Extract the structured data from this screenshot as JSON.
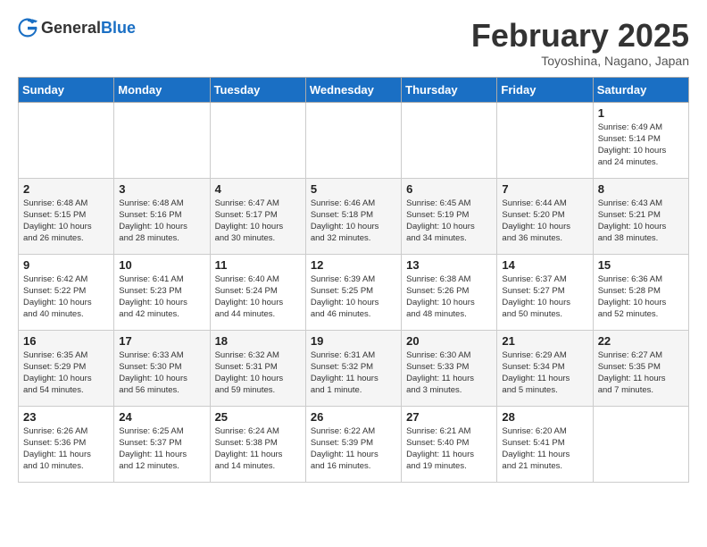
{
  "header": {
    "logo": {
      "general": "General",
      "blue": "Blue"
    },
    "title": "February 2025",
    "subtitle": "Toyoshina, Nagano, Japan"
  },
  "weekdays": [
    "Sunday",
    "Monday",
    "Tuesday",
    "Wednesday",
    "Thursday",
    "Friday",
    "Saturday"
  ],
  "weeks": [
    [
      {
        "day": "",
        "info": ""
      },
      {
        "day": "",
        "info": ""
      },
      {
        "day": "",
        "info": ""
      },
      {
        "day": "",
        "info": ""
      },
      {
        "day": "",
        "info": ""
      },
      {
        "day": "",
        "info": ""
      },
      {
        "day": "1",
        "info": "Sunrise: 6:49 AM\nSunset: 5:14 PM\nDaylight: 10 hours\nand 24 minutes."
      }
    ],
    [
      {
        "day": "2",
        "info": "Sunrise: 6:48 AM\nSunset: 5:15 PM\nDaylight: 10 hours\nand 26 minutes."
      },
      {
        "day": "3",
        "info": "Sunrise: 6:48 AM\nSunset: 5:16 PM\nDaylight: 10 hours\nand 28 minutes."
      },
      {
        "day": "4",
        "info": "Sunrise: 6:47 AM\nSunset: 5:17 PM\nDaylight: 10 hours\nand 30 minutes."
      },
      {
        "day": "5",
        "info": "Sunrise: 6:46 AM\nSunset: 5:18 PM\nDaylight: 10 hours\nand 32 minutes."
      },
      {
        "day": "6",
        "info": "Sunrise: 6:45 AM\nSunset: 5:19 PM\nDaylight: 10 hours\nand 34 minutes."
      },
      {
        "day": "7",
        "info": "Sunrise: 6:44 AM\nSunset: 5:20 PM\nDaylight: 10 hours\nand 36 minutes."
      },
      {
        "day": "8",
        "info": "Sunrise: 6:43 AM\nSunset: 5:21 PM\nDaylight: 10 hours\nand 38 minutes."
      }
    ],
    [
      {
        "day": "9",
        "info": "Sunrise: 6:42 AM\nSunset: 5:22 PM\nDaylight: 10 hours\nand 40 minutes."
      },
      {
        "day": "10",
        "info": "Sunrise: 6:41 AM\nSunset: 5:23 PM\nDaylight: 10 hours\nand 42 minutes."
      },
      {
        "day": "11",
        "info": "Sunrise: 6:40 AM\nSunset: 5:24 PM\nDaylight: 10 hours\nand 44 minutes."
      },
      {
        "day": "12",
        "info": "Sunrise: 6:39 AM\nSunset: 5:25 PM\nDaylight: 10 hours\nand 46 minutes."
      },
      {
        "day": "13",
        "info": "Sunrise: 6:38 AM\nSunset: 5:26 PM\nDaylight: 10 hours\nand 48 minutes."
      },
      {
        "day": "14",
        "info": "Sunrise: 6:37 AM\nSunset: 5:27 PM\nDaylight: 10 hours\nand 50 minutes."
      },
      {
        "day": "15",
        "info": "Sunrise: 6:36 AM\nSunset: 5:28 PM\nDaylight: 10 hours\nand 52 minutes."
      }
    ],
    [
      {
        "day": "16",
        "info": "Sunrise: 6:35 AM\nSunset: 5:29 PM\nDaylight: 10 hours\nand 54 minutes."
      },
      {
        "day": "17",
        "info": "Sunrise: 6:33 AM\nSunset: 5:30 PM\nDaylight: 10 hours\nand 56 minutes."
      },
      {
        "day": "18",
        "info": "Sunrise: 6:32 AM\nSunset: 5:31 PM\nDaylight: 10 hours\nand 59 minutes."
      },
      {
        "day": "19",
        "info": "Sunrise: 6:31 AM\nSunset: 5:32 PM\nDaylight: 11 hours\nand 1 minute."
      },
      {
        "day": "20",
        "info": "Sunrise: 6:30 AM\nSunset: 5:33 PM\nDaylight: 11 hours\nand 3 minutes."
      },
      {
        "day": "21",
        "info": "Sunrise: 6:29 AM\nSunset: 5:34 PM\nDaylight: 11 hours\nand 5 minutes."
      },
      {
        "day": "22",
        "info": "Sunrise: 6:27 AM\nSunset: 5:35 PM\nDaylight: 11 hours\nand 7 minutes."
      }
    ],
    [
      {
        "day": "23",
        "info": "Sunrise: 6:26 AM\nSunset: 5:36 PM\nDaylight: 11 hours\nand 10 minutes."
      },
      {
        "day": "24",
        "info": "Sunrise: 6:25 AM\nSunset: 5:37 PM\nDaylight: 11 hours\nand 12 minutes."
      },
      {
        "day": "25",
        "info": "Sunrise: 6:24 AM\nSunset: 5:38 PM\nDaylight: 11 hours\nand 14 minutes."
      },
      {
        "day": "26",
        "info": "Sunrise: 6:22 AM\nSunset: 5:39 PM\nDaylight: 11 hours\nand 16 minutes."
      },
      {
        "day": "27",
        "info": "Sunrise: 6:21 AM\nSunset: 5:40 PM\nDaylight: 11 hours\nand 19 minutes."
      },
      {
        "day": "28",
        "info": "Sunrise: 6:20 AM\nSunset: 5:41 PM\nDaylight: 11 hours\nand 21 minutes."
      },
      {
        "day": "",
        "info": ""
      }
    ]
  ]
}
